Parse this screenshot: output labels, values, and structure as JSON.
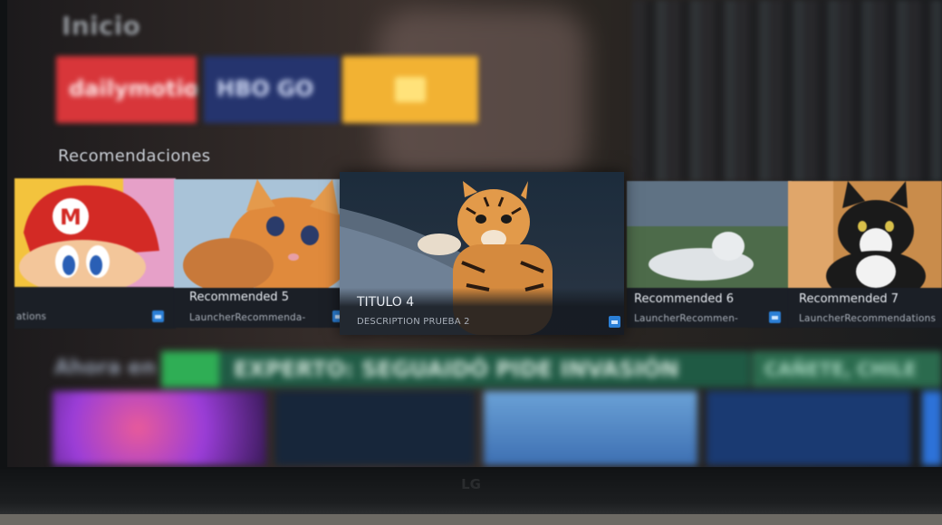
{
  "home": {
    "section_title": "Inicio"
  },
  "apps": [
    {
      "name": "dailymotion",
      "label": "dailymotion",
      "color": "#d8363a"
    },
    {
      "name": "HBO GO",
      "label": "HBO GO",
      "color": "#25346e"
    },
    {
      "name": "app",
      "label": "",
      "color": "#f2b233"
    }
  ],
  "recommendations": {
    "section_title": "Recomendaciones",
    "cards": [
      {
        "title": "",
        "subtitle": "ations",
        "icon": "mario-thumbnail"
      },
      {
        "title": "Recommended 5",
        "subtitle": "LauncherRecommenda-",
        "icon": "kitten-thumbnail"
      },
      {
        "title": "TITULO 4",
        "subtitle": "DESCRIPTION PRUEBA 2",
        "icon": "tiger-cub-thumbnail",
        "focused": true
      },
      {
        "title": "Recommended 6",
        "subtitle": "LauncherRecommen-",
        "icon": "white-lion-thumbnail"
      },
      {
        "title": "Recommended 7",
        "subtitle": "LauncherRecommendations",
        "icon": "cat-thumbnail"
      }
    ],
    "badge_color": "#2b7fd6"
  },
  "bottom_row": {
    "label": "Ahora en TV",
    "headline": "EXPERTO: SEGUAIDÓ PIDE INVASIÓN",
    "headline_right": "CAÑETE, CHILE"
  },
  "tv": {
    "brand": "LG"
  }
}
